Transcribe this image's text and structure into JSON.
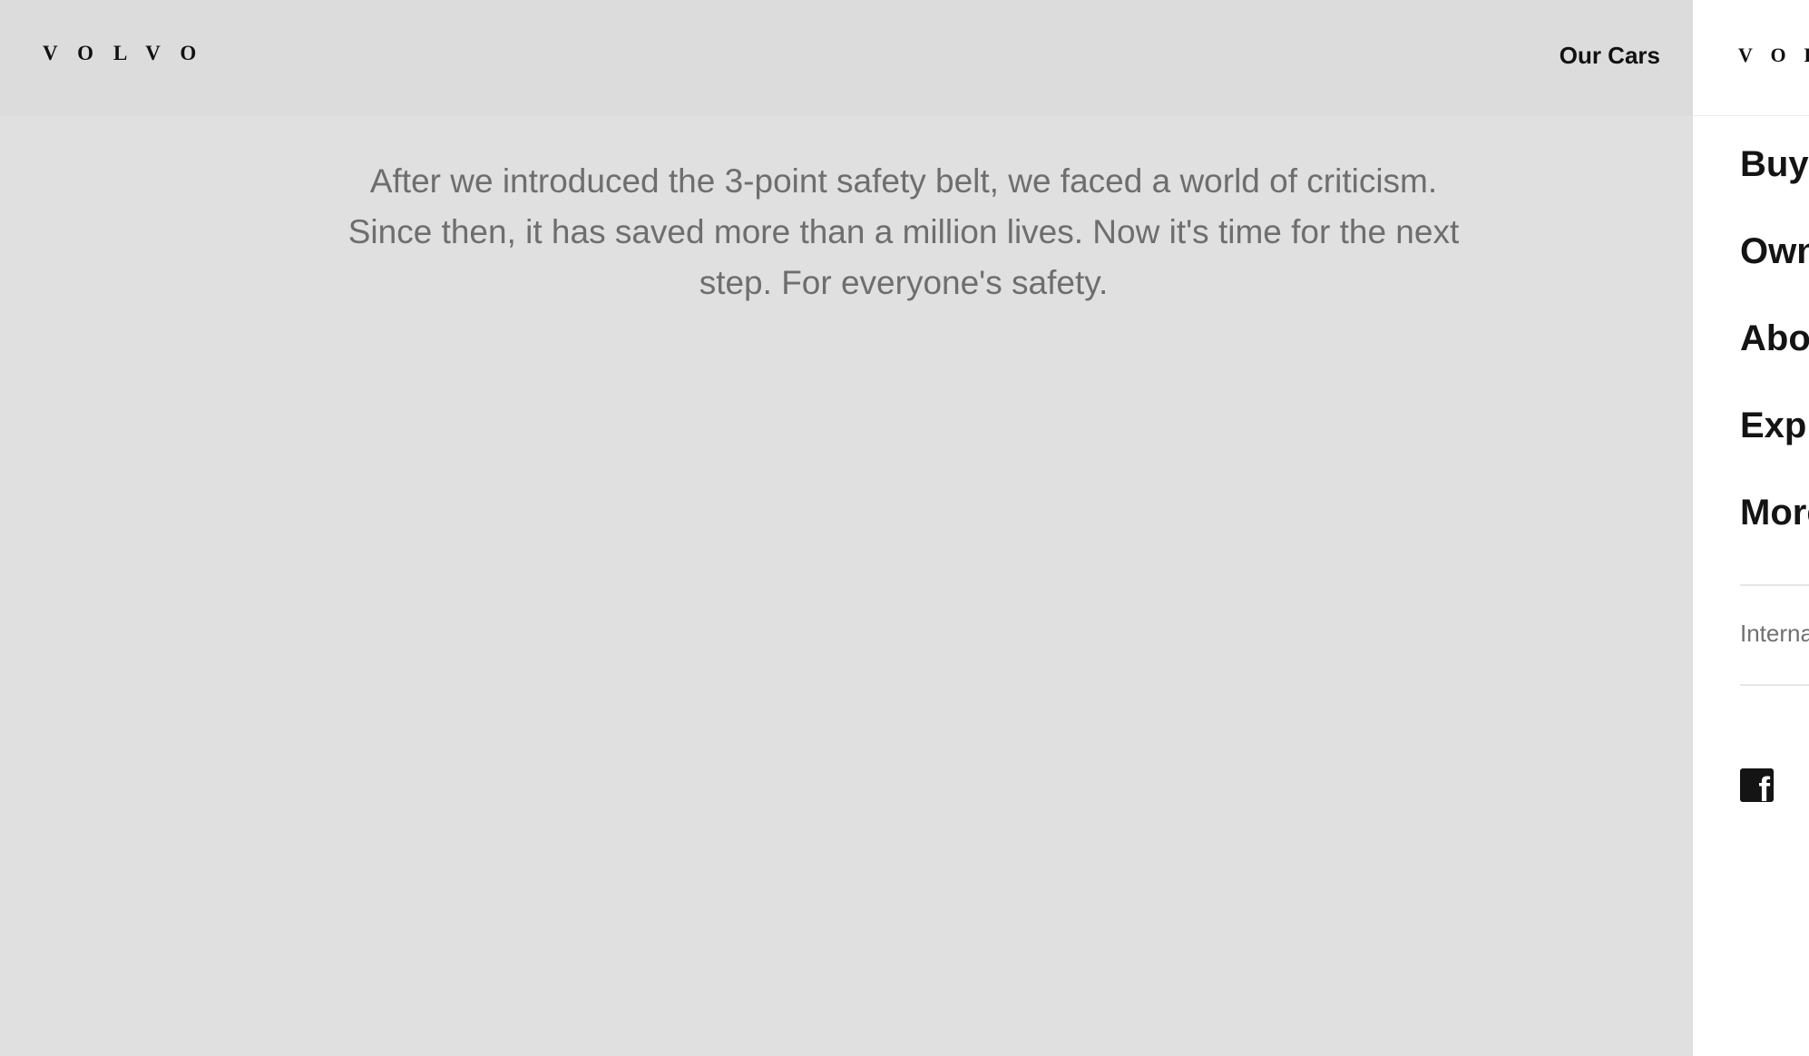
{
  "header": {
    "logo_text": "VOLVO",
    "nav_link": "Our Cars"
  },
  "intro": {
    "text": "After we introduced the 3-point safety belt, we faced a world of criticism. Since then, it has saved more than a million lives. Now it's time for the next step. For everyone's safety."
  },
  "drawer": {
    "logo_text": "VOLVO",
    "menu": [
      {
        "label": "Buy"
      },
      {
        "label": "Own"
      },
      {
        "label": "About"
      },
      {
        "label": "Explore"
      },
      {
        "label": "More"
      }
    ],
    "international_label": "International",
    "social": [
      {
        "icon": "facebook-icon",
        "glyph": "f"
      }
    ]
  }
}
